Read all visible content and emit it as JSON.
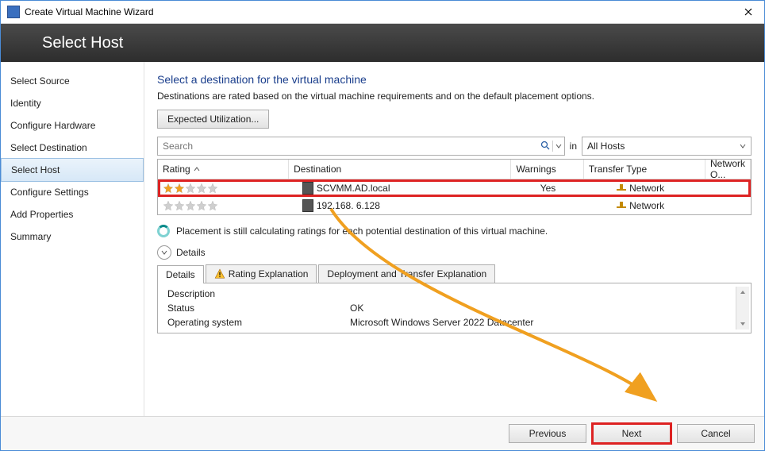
{
  "window": {
    "title": "Create Virtual Machine Wizard"
  },
  "banner": {
    "title": "Select Host"
  },
  "sidebar": {
    "steps": [
      {
        "label": "Select Source"
      },
      {
        "label": "Identity"
      },
      {
        "label": "Configure Hardware"
      },
      {
        "label": "Select Destination"
      },
      {
        "label": "Select Host"
      },
      {
        "label": "Configure Settings"
      },
      {
        "label": "Add Properties"
      },
      {
        "label": "Summary"
      }
    ],
    "active_index": 4
  },
  "main": {
    "heading": "Select a destination for the virtual machine",
    "subtext": "Destinations are rated based on the virtual machine requirements and on the default placement options.",
    "expected_util_btn": "Expected Utilization...",
    "search": {
      "placeholder": "Search",
      "in_label": "in",
      "scope": "All Hosts"
    },
    "columns": {
      "rating": "Rating",
      "destination": "Destination",
      "warnings": "Warnings",
      "transfer_type": "Transfer Type",
      "network_opt": "Network O..."
    },
    "rows": [
      {
        "rating_stars": 2,
        "destination": "SCVMM.AD.local",
        "warnings": "Yes",
        "transfer_type": "Network",
        "highlight": true
      },
      {
        "rating_stars": 0,
        "destination": "192.168.  6.128",
        "warnings": "",
        "transfer_type": "Network",
        "highlight": false
      }
    ],
    "status_msg": "Placement is still calculating ratings for each potential destination of this virtual machine.",
    "details_toggle": "Details",
    "tabs": [
      {
        "label": "Details",
        "warn": false
      },
      {
        "label": "Rating Explanation",
        "warn": true
      },
      {
        "label": "Deployment and Transfer Explanation",
        "warn": false
      }
    ],
    "details_rows": [
      {
        "label": "Description",
        "value": ""
      },
      {
        "label": "Status",
        "value": "OK"
      },
      {
        "label": "Operating system",
        "value": "Microsoft Windows Server 2022 Datacenter"
      }
    ]
  },
  "footer": {
    "previous": "Previous",
    "next": "Next",
    "cancel": "Cancel"
  }
}
